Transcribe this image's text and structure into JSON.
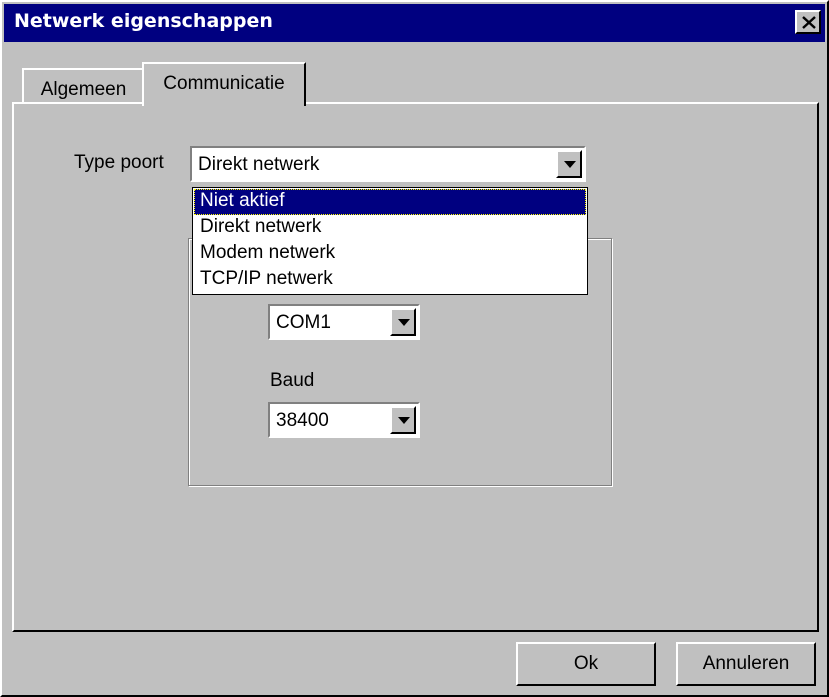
{
  "window": {
    "title": "Netwerk eigenschappen"
  },
  "tabs": [
    {
      "label": "Algemeen",
      "active": false
    },
    {
      "label": "Communicatie",
      "active": true
    }
  ],
  "port_type": {
    "label": "Type poort",
    "value": "Direkt netwerk",
    "options": [
      "Niet aktief",
      "Direkt netwerk",
      "Modem netwerk",
      "TCP/IP netwerk"
    ],
    "highlighted": "Niet aktief"
  },
  "com_port": {
    "value": "COM1"
  },
  "baud": {
    "label": "Baud",
    "value": "38400"
  },
  "buttons": {
    "ok": "Ok",
    "cancel": "Annuleren"
  },
  "icons": {
    "close": "close-icon",
    "dropdown": "chevron-down-icon"
  },
  "colors": {
    "titlebar": "#000080",
    "face": "#c0c0c0",
    "selection": "#000080"
  }
}
